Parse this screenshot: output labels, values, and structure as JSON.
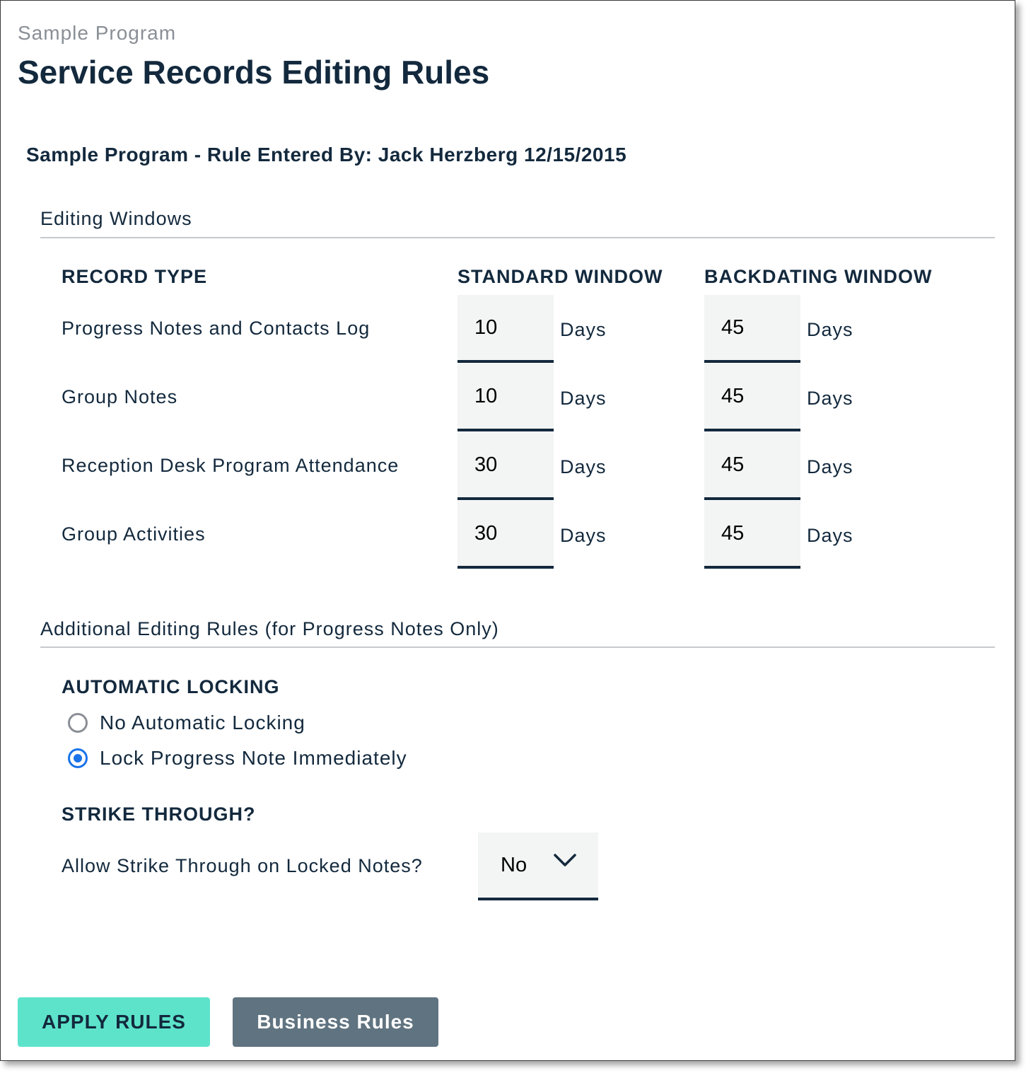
{
  "header": {
    "program": "Sample Program",
    "title": "Service Records Editing Rules",
    "entered_by": "Sample Program - Rule Entered By: Jack Herzberg 12/15/2015"
  },
  "editing_windows": {
    "section_title": "Editing Windows",
    "columns": {
      "record_type": "RECORD TYPE",
      "standard": "STANDARD WINDOW",
      "backdating": "BACKDATING WINDOW"
    },
    "unit": "Days",
    "rows": [
      {
        "label": "Progress Notes and Contacts Log",
        "standard": "10",
        "backdating": "45"
      },
      {
        "label": "Group Notes",
        "standard": "10",
        "backdating": "45"
      },
      {
        "label": "Reception Desk Program Attendance",
        "standard": "30",
        "backdating": "45"
      },
      {
        "label": "Group Activities",
        "standard": "30",
        "backdating": "45"
      }
    ]
  },
  "additional_rules": {
    "section_title": "Additional Editing Rules (for Progress Notes Only)",
    "automatic_locking": {
      "header": "AUTOMATIC LOCKING",
      "options": [
        {
          "label": "No Automatic Locking",
          "checked": false
        },
        {
          "label": "Lock Progress Note Immediately",
          "checked": true
        }
      ]
    },
    "strike_through": {
      "header": "STRIKE THROUGH?",
      "question": "Allow Strike Through on Locked Notes?",
      "selected": "No"
    }
  },
  "buttons": {
    "apply": "APPLY RULES",
    "business": "Business Rules"
  },
  "colors": {
    "text": "#13293d",
    "apply_bg": "#5ee3cb",
    "business_bg": "#607380",
    "radio_active": "#1a73e8",
    "input_bg": "#f3f4f4"
  }
}
